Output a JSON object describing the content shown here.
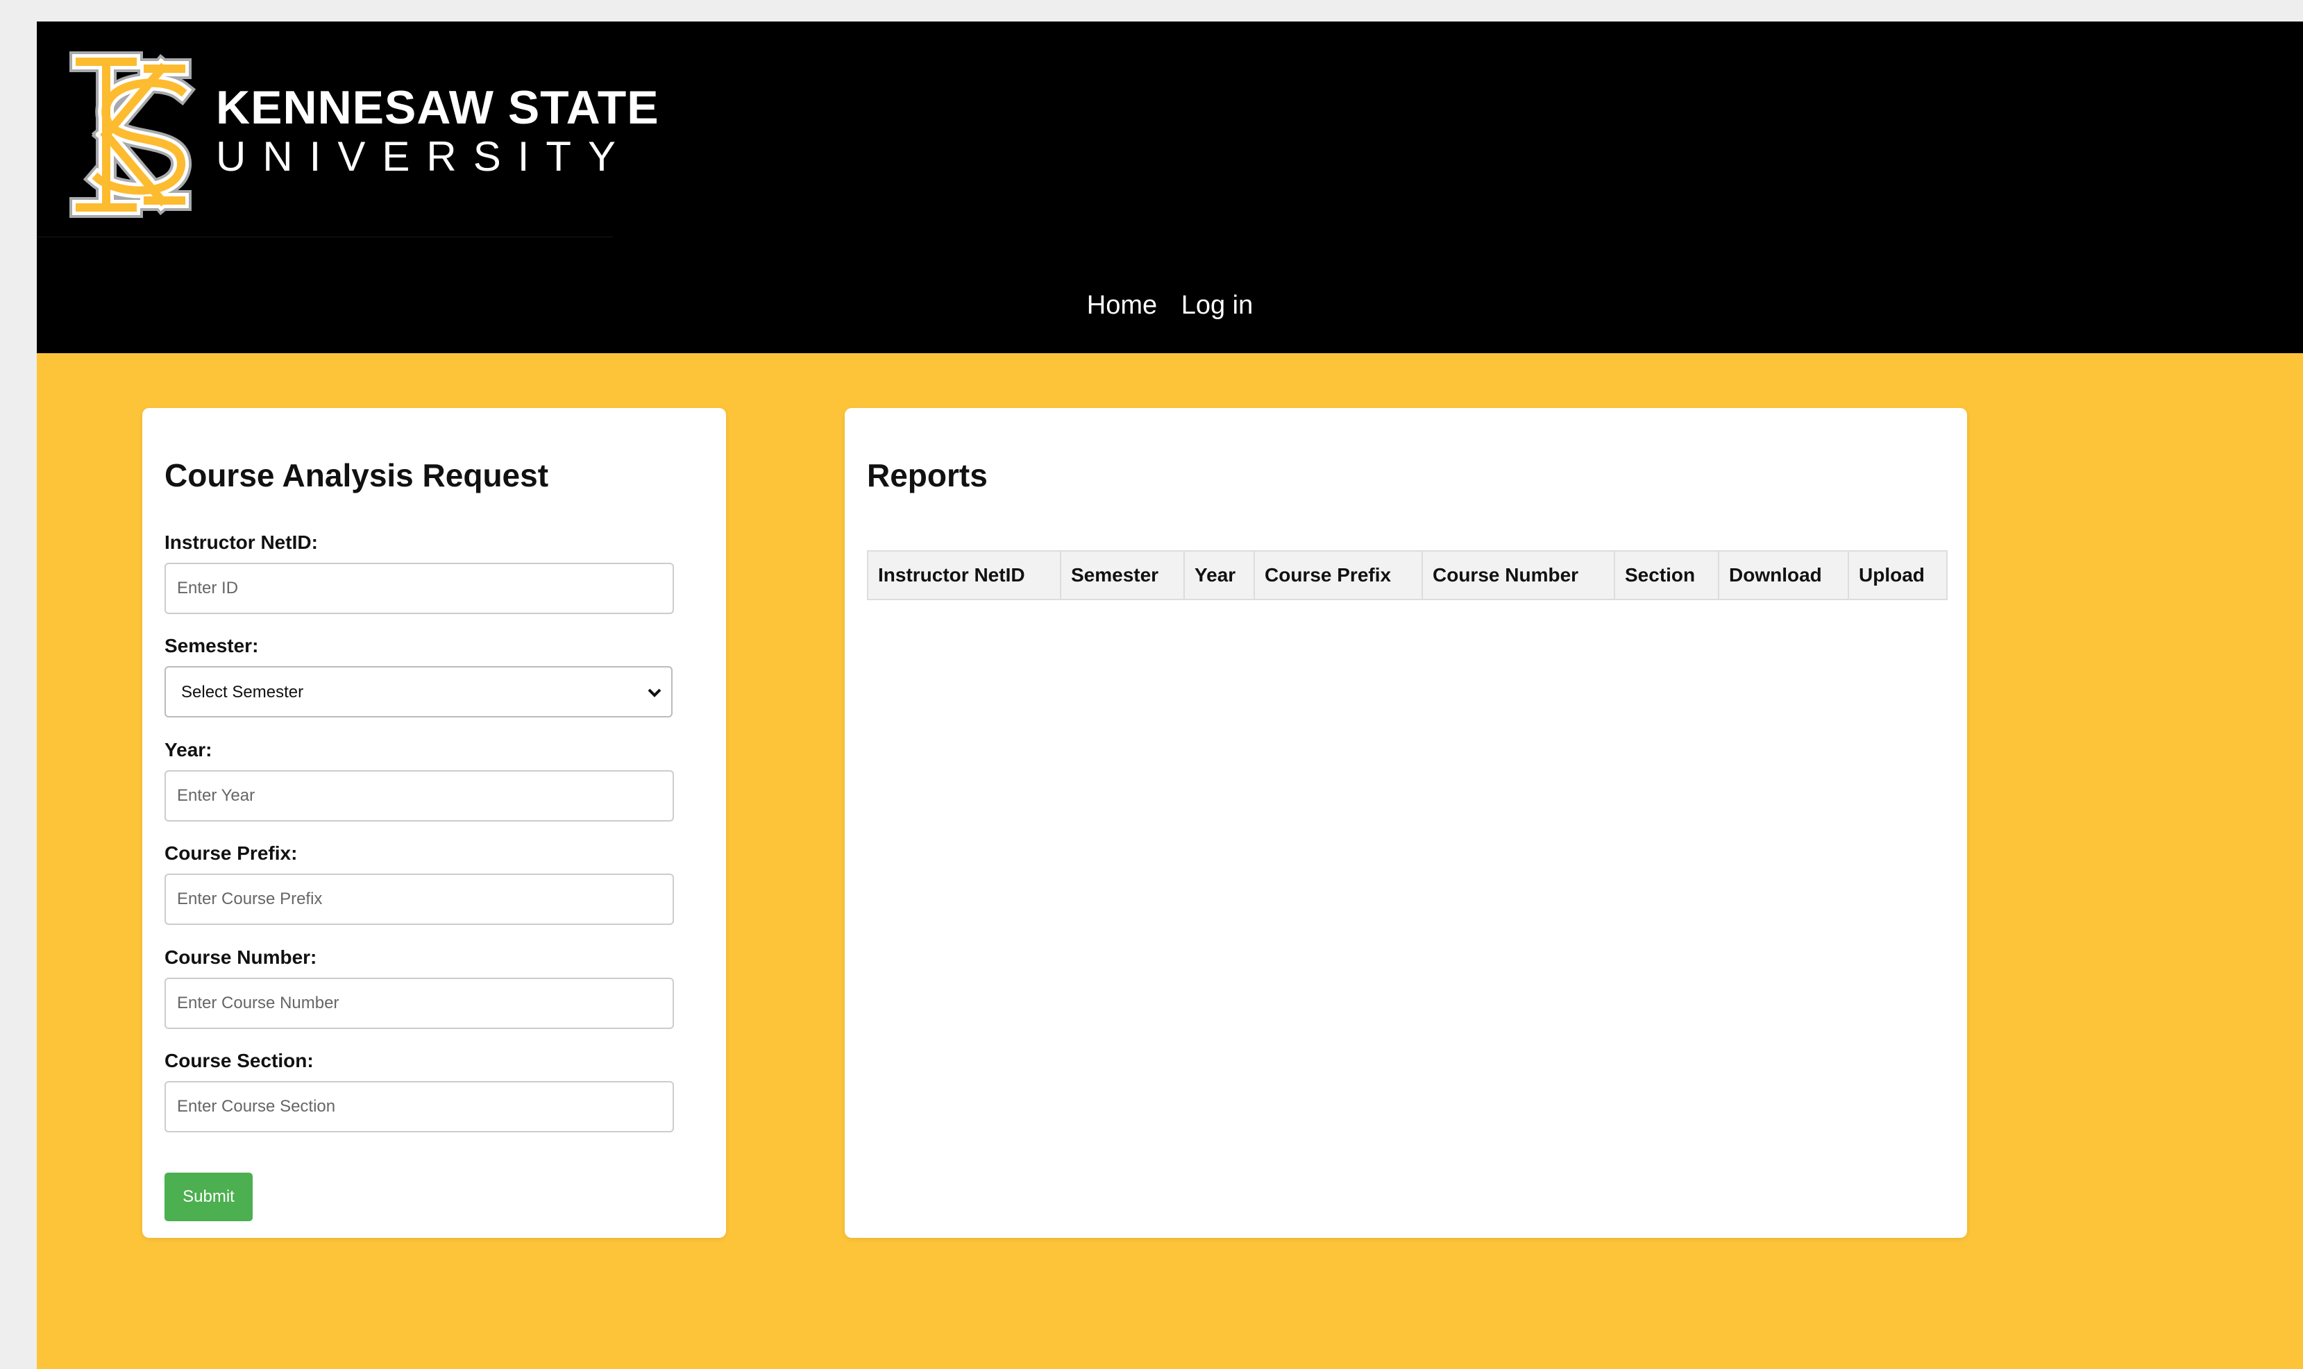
{
  "header": {
    "logo": {
      "monogram": "KS",
      "line1": "KENNESAW STATE",
      "line2": "UNIVERSITY"
    },
    "nav": [
      {
        "label": "Home"
      },
      {
        "label": "Log in"
      }
    ]
  },
  "form": {
    "title": "Course Analysis Request",
    "fields": {
      "netid": {
        "label": "Instructor NetID:",
        "placeholder": "Enter ID",
        "value": ""
      },
      "semester": {
        "label": "Semester:",
        "selected": "Select Semester"
      },
      "year": {
        "label": "Year:",
        "placeholder": "Enter Year",
        "value": ""
      },
      "prefix": {
        "label": "Course Prefix:",
        "placeholder": "Enter Course Prefix",
        "value": ""
      },
      "number": {
        "label": "Course Number:",
        "placeholder": "Enter Course Number",
        "value": ""
      },
      "section": {
        "label": "Course Section:",
        "placeholder": "Enter Course Section",
        "value": ""
      }
    },
    "submit_label": "Submit"
  },
  "reports": {
    "title": "Reports",
    "columns": [
      "Instructor NetID",
      "Semester",
      "Year",
      "Course Prefix",
      "Course Number",
      "Section",
      "Download",
      "Upload"
    ],
    "rows": []
  },
  "icons": {
    "logo": "kennesaw-state-logo-icon",
    "select": "chevron-down-icon"
  },
  "colors": {
    "page_background": "#fdc439",
    "header_background": "#000000",
    "brand_gold": "#fdbb30",
    "submit_button": "#4caf50",
    "table_header": "#f2f2f2"
  }
}
